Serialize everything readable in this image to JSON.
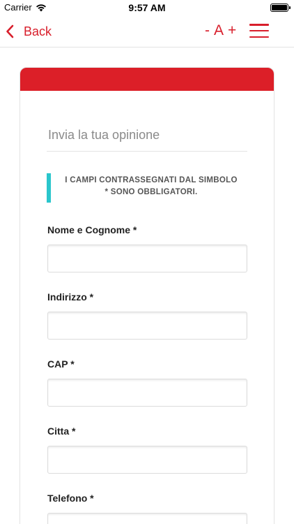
{
  "status_bar": {
    "carrier": "Carrier",
    "time": "9:57 AM"
  },
  "nav": {
    "back_label": "Back",
    "font_decrease": "-",
    "font_label": "A",
    "font_increase": "+",
    "accent_color": "#d81e2b"
  },
  "form": {
    "title": "Invia la tua opinione",
    "notice_line1": "I CAMPI CONTRASSEGNATI DAL SIMBOLO",
    "notice_line2": "* SONO OBBLIGATORI.",
    "header_color": "#dc1f28",
    "notice_color": "#2ac6cc",
    "fields": [
      {
        "label": "Nome e Cognome *",
        "value": ""
      },
      {
        "label": "Indirizzo *",
        "value": ""
      },
      {
        "label": "CAP *",
        "value": ""
      },
      {
        "label": "Citta *",
        "value": ""
      },
      {
        "label": "Telefono *",
        "value": ""
      }
    ]
  }
}
